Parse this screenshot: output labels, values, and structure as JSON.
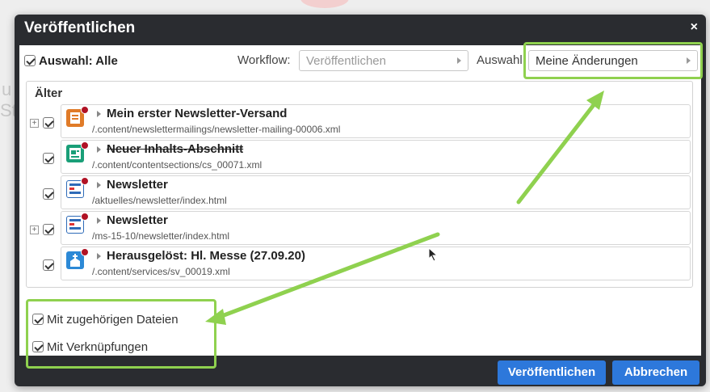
{
  "dialog": {
    "title": "Veröffentlichen",
    "close": "×"
  },
  "toolbar": {
    "select_all": "Auswahl: Alle",
    "workflow_label": "Workflow:",
    "workflow_value": "Veröffentlichen",
    "auswahl_label": "Auswahl:",
    "auswahl_value": "Meine Änderungen"
  },
  "list": {
    "group_label": "Älter",
    "items": [
      {
        "name": "Mein erster Newsletter-Versand",
        "path": "/.content/newslettermailings/newsletter-mailing-00006.xml",
        "icon": "newsletter-mailing-icon",
        "color": "#e07b28",
        "struck": false,
        "expandable": true
      },
      {
        "name": "Neuer Inhalts-Abschnitt",
        "path": "/.content/contentsections/cs_00071.xml",
        "icon": "content-section-icon",
        "color": "#1a9f78",
        "struck": true,
        "expandable": false
      },
      {
        "name": "Newsletter",
        "path": "/aktuelles/newsletter/index.html",
        "icon": "page-icon",
        "color": "#2e6bb8",
        "struck": false,
        "expandable": false
      },
      {
        "name": "Newsletter",
        "path": "/ms-15-10/newsletter/index.html",
        "icon": "page-icon",
        "color": "#2e6bb8",
        "struck": false,
        "expandable": true
      },
      {
        "name": "Herausgelöst: Hl. Messe (27.09.20)",
        "path": "/.content/services/sv_00019.xml",
        "icon": "service-icon",
        "color": "#2c89d6",
        "struck": false,
        "expandable": false
      }
    ]
  },
  "options": {
    "related_files": "Mit zugehörigen Dateien",
    "links": "Mit Verknüpfungen"
  },
  "buttons": {
    "publish": "Veröffentlichen",
    "cancel": "Abbrechen"
  },
  "colors": {
    "dialog_bg": "#2a2c30",
    "button_blue": "#2d78db",
    "highlight_green": "#8fd14f",
    "status_dot": "#b01225"
  }
}
